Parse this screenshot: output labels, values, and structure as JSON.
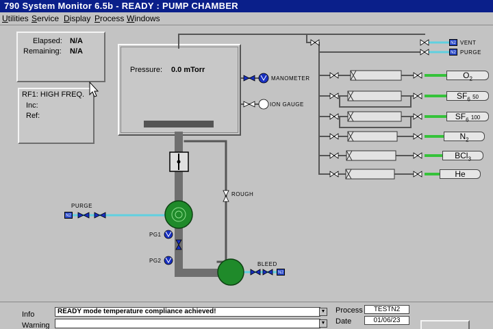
{
  "window": {
    "title": "790 System Monitor 6.5b - READY : PUMP CHAMBER"
  },
  "menu": {
    "items": [
      "Utilities",
      "Service",
      "Display",
      "Process",
      "Windows"
    ]
  },
  "timer": {
    "elapsed_label": "Elapsed:",
    "elapsed_value": "N/A",
    "remaining_label": "Remaining:",
    "remaining_value": "N/A"
  },
  "rf": {
    "title": "RF1: HIGH FREQ.",
    "inc_label": "Inc:",
    "ref_label": "Ref:"
  },
  "chamber": {
    "pressure_label": "Pressure:",
    "pressure_value": "0.0 mTorr"
  },
  "gauges": {
    "manometer": "MANOMETER",
    "ion_gauge": "ION GAUGE"
  },
  "valves": {
    "vent": "VENT",
    "purge_top": "PURGE",
    "rough": "ROUGH",
    "purge_left": "PURGE",
    "pg1": "PG1",
    "pg2": "PG2",
    "bleed": "BLEED",
    "n2_tag": "N2"
  },
  "gases": [
    {
      "name": "O",
      "sub": "2",
      "extra": ""
    },
    {
      "name": "SF",
      "sub": "6",
      "extra": "50"
    },
    {
      "name": "SF",
      "sub": "6",
      "extra": "100"
    },
    {
      "name": "N",
      "sub": "2",
      "extra": ""
    },
    {
      "name": "BCl",
      "sub": "3",
      "extra": ""
    },
    {
      "name": "He",
      "sub": "",
      "extra": ""
    }
  ],
  "status": {
    "info_label": "Info",
    "info_message": "READY mode temperature compliance achieved!",
    "warning_label": "Warning",
    "process_label": "Process",
    "process_value": "TESTN2",
    "date_label": "Date",
    "date_value": "01/06/23"
  },
  "colors": {
    "pump": "#1f8a2a",
    "gas_green": "#35c23a",
    "cyan_line": "#5fd0e0",
    "valve_blue": "#1830c0",
    "pipe": "#6f6f6f"
  }
}
